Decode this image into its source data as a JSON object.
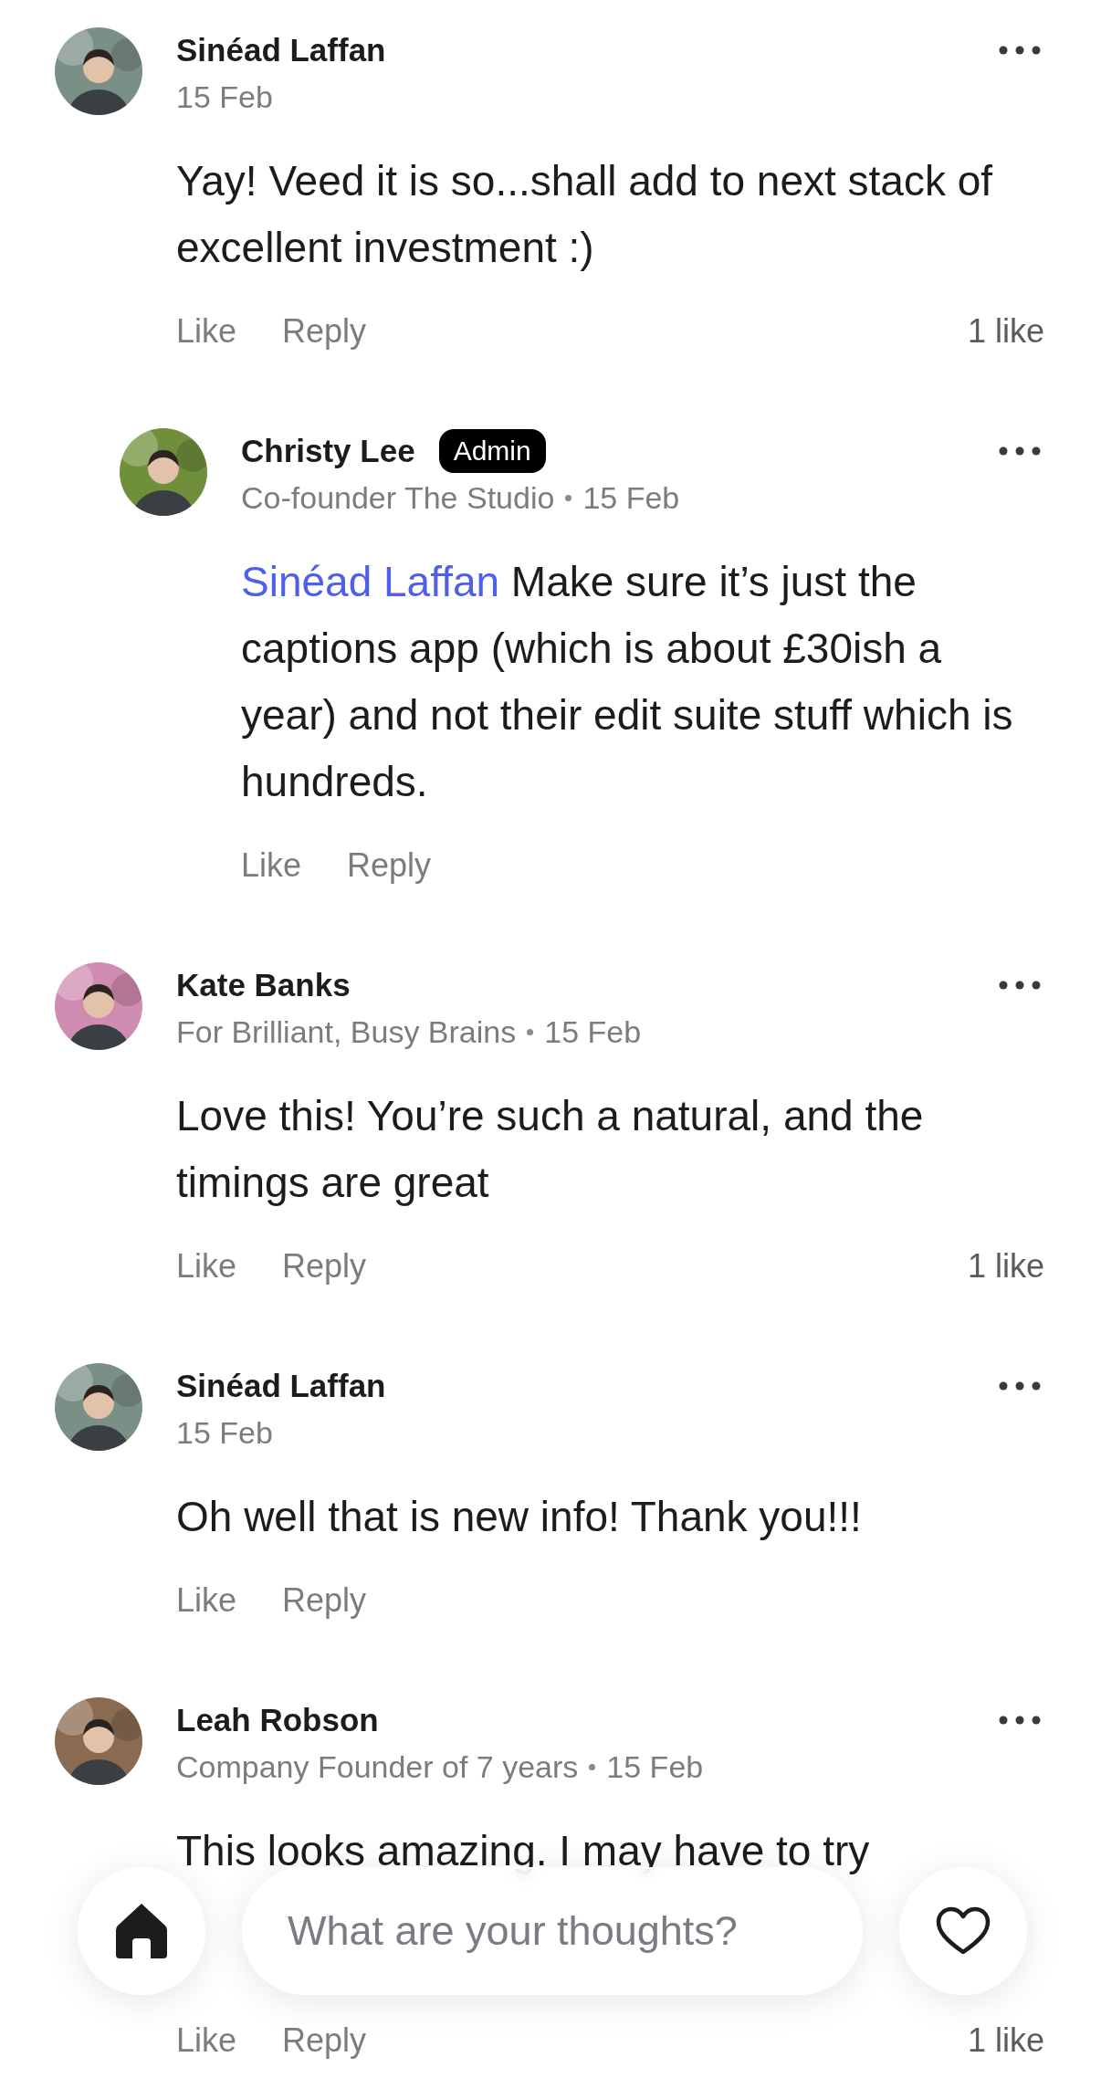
{
  "comments": [
    {
      "author": "Sinéad Laffan",
      "date": "15 Feb",
      "body": "Yay! Veed it is so...shall add to next stack of excellent investment :)",
      "like_label": "Like",
      "reply_label": "Reply",
      "like_count": "1 like",
      "children": [
        {
          "author": "Christy Lee",
          "badge": "Admin",
          "subtitle": "Co-founder The Studio",
          "date": "15 Feb",
          "mention": "Sinéad Laffan",
          "body": "Make sure it’s just the captions app (which is about £30ish a year) and not their edit suite stuff which is hundreds.",
          "like_label": "Like",
          "reply_label": "Reply"
        }
      ]
    },
    {
      "author": "Kate Banks",
      "subtitle": "For Brilliant, Busy Brains",
      "date": "15 Feb",
      "body": "Love this! You’re such a natural, and the timings are great",
      "like_label": "Like",
      "reply_label": "Reply",
      "like_count": "1 like"
    },
    {
      "author": "Sinéad Laffan",
      "date": "15 Feb",
      "body": "Oh well that is new info! Thank you!!!",
      "like_label": "Like",
      "reply_label": "Reply"
    },
    {
      "author": "Leah Robson",
      "subtitle": "Company Founder of 7 years",
      "date": "15 Feb",
      "body": "This looks amazing. I may have to try",
      "like_label": "Like",
      "reply_label": "Reply",
      "like_count": "1 like"
    }
  ],
  "composer": {
    "placeholder": "What are your thoughts?"
  }
}
